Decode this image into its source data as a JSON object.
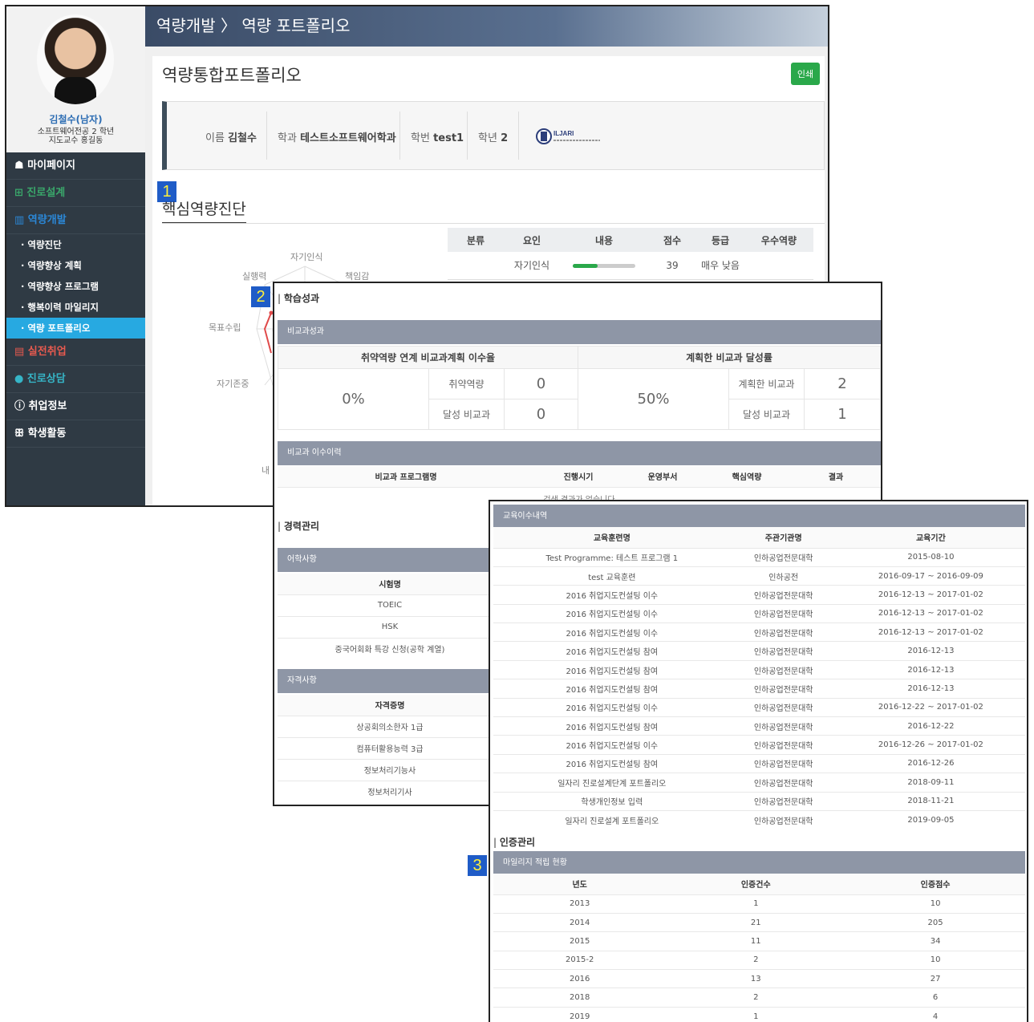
{
  "topbar": {
    "breadcrumb": "역량개발 〉 역량 포트폴리오"
  },
  "profile": {
    "name": "김철수(남자)",
    "dept": "소프트웨어전공 2 학년",
    "advisor": "지도교수 홍길동"
  },
  "menu": [
    {
      "label": "☗ 마이페이지",
      "type": "m"
    },
    {
      "label": "⊞ 진로설계",
      "type": "m green"
    },
    {
      "label": "▥ 역량개발",
      "type": "m blue"
    },
    {
      "label": "· 역량진단",
      "type": "s"
    },
    {
      "label": "· 역량향상 계획",
      "type": "s"
    },
    {
      "label": "· 역량향상 프로그램",
      "type": "s"
    },
    {
      "label": "· 행복이력 마일리지",
      "type": "s"
    },
    {
      "label": "· 역량 포트폴리오",
      "type": "s active"
    },
    {
      "label": "▤ 실전취업",
      "type": "m red"
    },
    {
      "label": "● 진로상담",
      "type": "m teal"
    },
    {
      "label": "ⓘ 취업정보",
      "type": "m"
    },
    {
      "label": "ꕥ 학생활동",
      "type": "m"
    }
  ],
  "page": {
    "title": "역량통합포트폴리오",
    "print": "인쇄"
  },
  "info": {
    "name_label": "이름",
    "name": "김철수",
    "dept_label": "학과",
    "dept": "테스트소프트웨어학과",
    "id_label": "학번",
    "id": "test1",
    "grade_label": "학년",
    "grade": "2",
    "logo_text": "ILJARI"
  },
  "markers": {
    "m1": "1",
    "m2": "2",
    "m3": "3"
  },
  "core": {
    "title": "핵심역량진단",
    "radar_labels": [
      "자기인식",
      "책임감",
      "실행력",
      "목표수립",
      "자기존중",
      "내 협"
    ],
    "table_headers": [
      "분류",
      "요인",
      "내용",
      "점수",
      "등급",
      "우수역량"
    ],
    "row": {
      "factor": "자기인식",
      "score": "39",
      "grade": "매우 낮음",
      "bar_pct": 40
    }
  },
  "learning": {
    "section": "학습성과",
    "bar": "비교과성과",
    "h1": "취약역량 연계 비교과계획 이수율",
    "h2": "계획한 비교과 달성률",
    "rate1": "0%",
    "rate2": "50%",
    "l_weak": "취약역량",
    "v_weak": "0",
    "l_ach1": "달성 비교과",
    "v_ach1": "0",
    "l_plan": "계획한 비교과",
    "v_plan": "2",
    "l_ach2": "달성 비교과",
    "v_ach2": "1",
    "hist_bar": "비교과 이수이력",
    "hist_headers": [
      "비교과 프로그램명",
      "진행시기",
      "운영부서",
      "핵심역량",
      "결과"
    ],
    "hist_empty": "검색 결과가 없습니다"
  },
  "career": {
    "section": "경력관리",
    "lang_bar": "어학사항",
    "lang_header": "시험명",
    "lang_rows": [
      "TOEIC",
      "HSK",
      "중국어회화 특강 신청(공학 계열)"
    ],
    "cert_bar": "자격사항",
    "cert_header": "자격증명",
    "cert_rows": [
      "상공회의소한자 1급",
      "컴퓨터활용능력 3급",
      "정보처리기능사",
      "정보처리기사"
    ]
  },
  "edu": {
    "bar": "교육이수내역",
    "headers": [
      "교육훈련명",
      "주관기관명",
      "교육기간"
    ],
    "rows": [
      [
        "Test Programme: 테스트 프로그램 1",
        "인하공업전문대학",
        "2015-08-10"
      ],
      [
        "test 교육훈련",
        "인하공전",
        "2016-09-17 ~ 2016-09-09"
      ],
      [
        "2016 취업지도컨설팅 이수",
        "인하공업전문대학",
        "2016-12-13 ~ 2017-01-02"
      ],
      [
        "2016 취업지도컨설팅 이수",
        "인하공업전문대학",
        "2016-12-13 ~ 2017-01-02"
      ],
      [
        "2016 취업지도컨설팅 이수",
        "인하공업전문대학",
        "2016-12-13 ~ 2017-01-02"
      ],
      [
        "2016 취업지도컨설팅 참여",
        "인하공업전문대학",
        "2016-12-13"
      ],
      [
        "2016 취업지도컨설팅 참여",
        "인하공업전문대학",
        "2016-12-13"
      ],
      [
        "2016 취업지도컨설팅 참여",
        "인하공업전문대학",
        "2016-12-13"
      ],
      [
        "2016 취업지도컨설팅 이수",
        "인하공업전문대학",
        "2016-12-22 ~ 2017-01-02"
      ],
      [
        "2016 취업지도컨설팅 참여",
        "인하공업전문대학",
        "2016-12-22"
      ],
      [
        "2016 취업지도컨설팅 이수",
        "인하공업전문대학",
        "2016-12-26 ~ 2017-01-02"
      ],
      [
        "2016 취업지도컨설팅 참여",
        "인하공업전문대학",
        "2016-12-26"
      ],
      [
        "일자리 진로설계단계 포트폴리오",
        "인하공업전문대학",
        "2018-09-11"
      ],
      [
        "학생개인정보 입력",
        "인하공업전문대학",
        "2018-11-21"
      ],
      [
        "일자리 진로설계 포트폴리오",
        "인하공업전문대학",
        "2019-09-05"
      ]
    ]
  },
  "cert": {
    "section": "인증관리",
    "bar": "마일리지 적립 현황",
    "headers": [
      "년도",
      "인증건수",
      "인증점수"
    ],
    "rows": [
      [
        "2013",
        "1",
        "10"
      ],
      [
        "2014",
        "21",
        "205"
      ],
      [
        "2015",
        "11",
        "34"
      ],
      [
        "2015-2",
        "2",
        "10"
      ],
      [
        "2016",
        "13",
        "27"
      ],
      [
        "2018",
        "2",
        "6"
      ],
      [
        "2019",
        "1",
        "4"
      ]
    ]
  }
}
